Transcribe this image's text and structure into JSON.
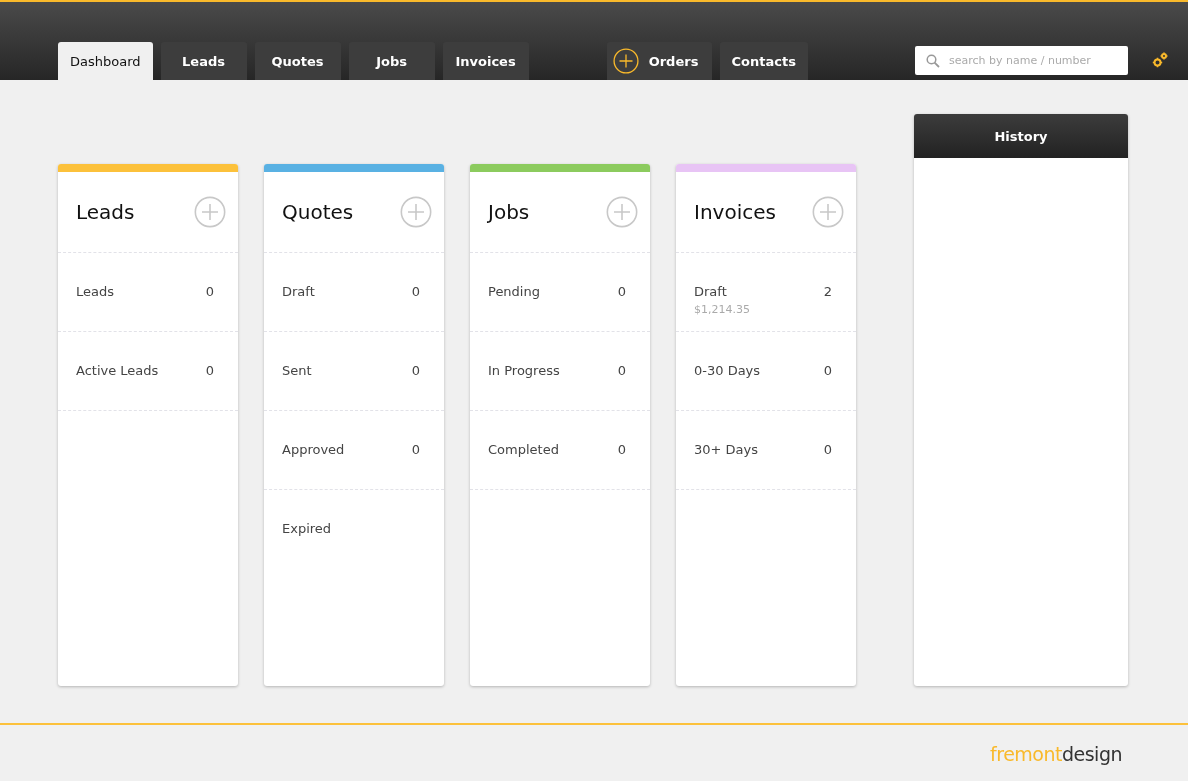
{
  "nav": {
    "tabs": [
      {
        "label": "Dashboard",
        "selected": true,
        "add_icon": false
      },
      {
        "label": "Leads",
        "selected": false,
        "add_icon": false
      },
      {
        "label": "Quotes",
        "selected": false,
        "add_icon": false
      },
      {
        "label": "Jobs",
        "selected": false,
        "add_icon": false
      },
      {
        "label": "Invoices",
        "selected": false,
        "add_icon": false
      },
      {
        "label": "Orders",
        "selected": false,
        "add_icon": true
      },
      {
        "label": "Contacts",
        "selected": false,
        "add_icon": false
      }
    ],
    "search": {
      "placeholder": "search by name / number"
    }
  },
  "cards": [
    {
      "title": "Leads",
      "color": "#fcc13b",
      "rows": [
        {
          "label": "Leads",
          "count": "0"
        },
        {
          "label": "Active Leads",
          "count": "0"
        }
      ]
    },
    {
      "title": "Quotes",
      "color": "#59b1e3",
      "rows": [
        {
          "label": "Draft",
          "count": "0"
        },
        {
          "label": "Sent",
          "count": "0"
        },
        {
          "label": "Approved",
          "count": "0"
        },
        {
          "label": "Expired"
        }
      ]
    },
    {
      "title": "Jobs",
      "color": "#8ccb5e",
      "rows": [
        {
          "label": "Pending",
          "count": "0"
        },
        {
          "label": "In Progress",
          "count": "0"
        },
        {
          "label": "Completed",
          "count": "0"
        }
      ]
    },
    {
      "title": "Invoices",
      "color": "#e8c4f5",
      "rows": [
        {
          "label": "Draft",
          "count": "2",
          "amount": "$1,214.35"
        },
        {
          "label": "0-30 Days",
          "count": "0"
        },
        {
          "label": "30+ Days",
          "count": "0"
        }
      ]
    }
  ],
  "history": {
    "title": "History"
  },
  "footer": {
    "logo": {
      "first": "fremont",
      "second": "design"
    }
  }
}
